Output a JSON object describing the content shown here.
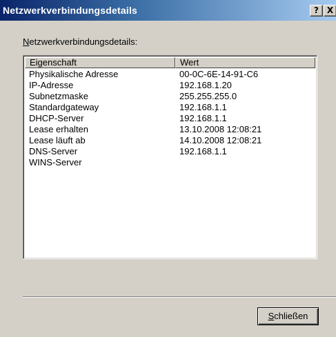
{
  "window": {
    "title": "Netzwerkverbindungsdetails",
    "help_button": "?",
    "close_button": "X"
  },
  "group": {
    "label_accel": "N",
    "label_rest": "etzwerkverbindungsdetails:"
  },
  "table": {
    "columns": [
      "Eigenschaft",
      "Wert"
    ],
    "rows": [
      {
        "property": "Physikalische Adresse",
        "value": "00-0C-6E-14-91-C6"
      },
      {
        "property": "IP-Adresse",
        "value": "192.168.1.20"
      },
      {
        "property": "Subnetzmaske",
        "value": "255.255.255.0"
      },
      {
        "property": "Standardgateway",
        "value": "192.168.1.1"
      },
      {
        "property": "DHCP-Server",
        "value": "192.168.1.1"
      },
      {
        "property": "Lease erhalten",
        "value": "13.10.2008 12:08:21"
      },
      {
        "property": "Lease läuft ab",
        "value": "14.10.2008 12:08:21"
      },
      {
        "property": "DNS-Server",
        "value": "192.168.1.1"
      },
      {
        "property": "WINS-Server",
        "value": ""
      }
    ]
  },
  "footer": {
    "close_accel": "S",
    "close_rest": "chließen"
  },
  "colors": {
    "titlebar_start": "#0a246a",
    "titlebar_end": "#a6caf0",
    "dialog_face": "#d4d0c8"
  }
}
